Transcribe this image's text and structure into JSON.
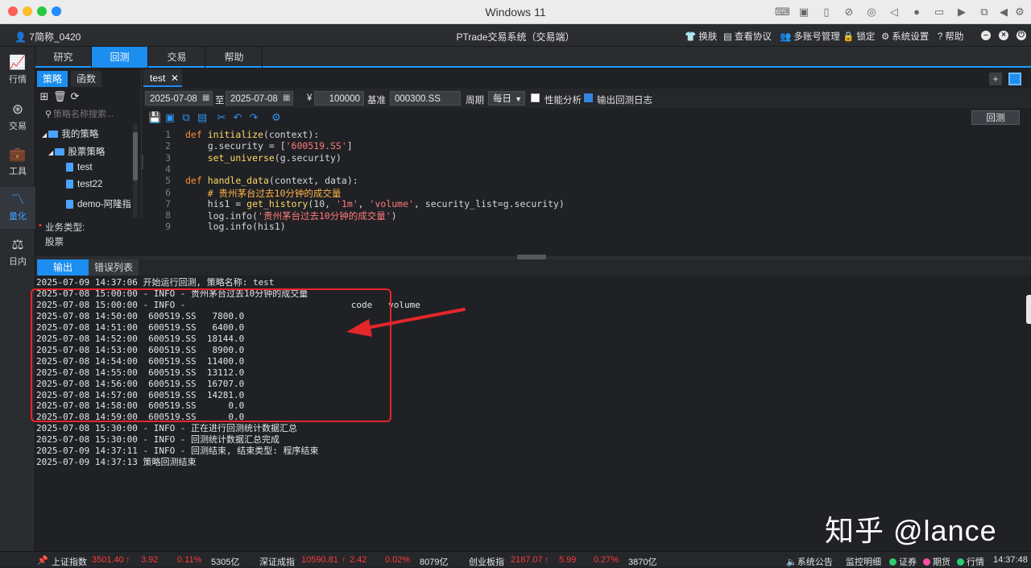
{
  "os": {
    "title": "Windows 11"
  },
  "app": {
    "user": "7简称_0420",
    "title": "PTrade交易系统（交易端）",
    "header_buttons": [
      "换肤",
      "查看协议",
      "多账号管理",
      "锁定",
      "系统设置",
      "帮助"
    ]
  },
  "rail": [
    {
      "label": "行情",
      "icon": "chart-line-icon"
    },
    {
      "label": "交易",
      "icon": "trade-icon"
    },
    {
      "label": "工具",
      "icon": "briefcase-icon"
    },
    {
      "label": "量化",
      "icon": "quant-icon"
    },
    {
      "label": "日内",
      "icon": "scale-icon"
    }
  ],
  "top_tabs": [
    "研究",
    "回测",
    "交易",
    "帮助"
  ],
  "side": {
    "tabs": [
      "策略",
      "函数"
    ],
    "search_placeholder": "策略名称搜索...",
    "tree": {
      "root": "我的策略",
      "group": "股票策略",
      "files": [
        "test",
        "test22",
        "demo-阿隆指"
      ]
    },
    "biz_label": "业务类型:",
    "biz_value": "股票"
  },
  "editor": {
    "tab": "test",
    "params": {
      "start": "2025-07-08",
      "to": "至",
      "end": "2025-07-08",
      "currency": "¥",
      "capital": "100000",
      "bench_label": "基准",
      "bench": "000300.SS",
      "period_label": "周期",
      "period": "每日",
      "perf": "性能分析",
      "log": "输出回测日志"
    },
    "run": "回测",
    "code": [
      {
        "n": "1",
        "t": "def initialize(context):"
      },
      {
        "n": "2",
        "t": "    g.security = ['600519.SS']"
      },
      {
        "n": "3",
        "t": "    set_universe(g.security)"
      },
      {
        "n": "4",
        "t": ""
      },
      {
        "n": "5",
        "t": "def handle_data(context, data):"
      },
      {
        "n": "6",
        "t": "    # 贵州茅台过去10分钟的成交量"
      },
      {
        "n": "7",
        "t": "    his1 = get_history(10, '1m', 'volume', security_list=g.security)"
      },
      {
        "n": "8",
        "t": "    log.info('贵州茅台过去10分钟的成交量')"
      },
      {
        "n": "9",
        "t": "    log.info(his1)"
      }
    ]
  },
  "output": {
    "tabs": [
      "输出",
      "错误列表"
    ],
    "lines": [
      "2025-07-09 14:37:06 开始运行回测, 策略名称: test",
      "2025-07-08 15:00:00 - INFO - 贵州茅台过去10分钟的成交量",
      "2025-07-08 15:00:00 - INFO -                               code   volume",
      "2025-07-08 14:50:00  600519.SS   7800.0",
      "2025-07-08 14:51:00  600519.SS   6400.0",
      "2025-07-08 14:52:00  600519.SS  18144.0",
      "2025-07-08 14:53:00  600519.SS   8900.0",
      "2025-07-08 14:54:00  600519.SS  11400.0",
      "2025-07-08 14:55:00  600519.SS  13112.0",
      "2025-07-08 14:56:00  600519.SS  16707.0",
      "2025-07-08 14:57:00  600519.SS  14281.0",
      "2025-07-08 14:58:00  600519.SS      0.0",
      "2025-07-08 14:59:00  600519.SS      0.0",
      "2025-07-08 15:30:00 - INFO - 正在进行回测统计数据汇总",
      "2025-07-08 15:30:00 - INFO - 回测统计数据汇总完成",
      "2025-07-09 14:37:11 - INFO - 回测结束, 结束类型: 程序结束",
      "2025-07-09 14:37:13 策略回测结束"
    ]
  },
  "watermark": "知乎 @lance",
  "status": {
    "indices": [
      {
        "name": "上证指数",
        "value": "3501.40",
        "chg": "3.92",
        "pct": "0.11%",
        "amt": "5305亿"
      },
      {
        "name": "深证成指",
        "value": "10590.81",
        "chg": "2.42",
        "pct": "0.02%",
        "amt": "8079亿"
      },
      {
        "name": "创业板指",
        "value": "2187.07",
        "chg": "5.99",
        "pct": "0.27%",
        "amt": "3870亿"
      }
    ],
    "right": {
      "notice": "系统公告",
      "monitor": "监控明细",
      "sec": "证券",
      "fut": "期货",
      "quote": "行情",
      "time": "14:37:48"
    },
    "colors": {
      "up": "#ff3b3b",
      "sec": "#2ecc71",
      "fut": "#ff4fa3",
      "quote": "#2ecc71"
    }
  }
}
